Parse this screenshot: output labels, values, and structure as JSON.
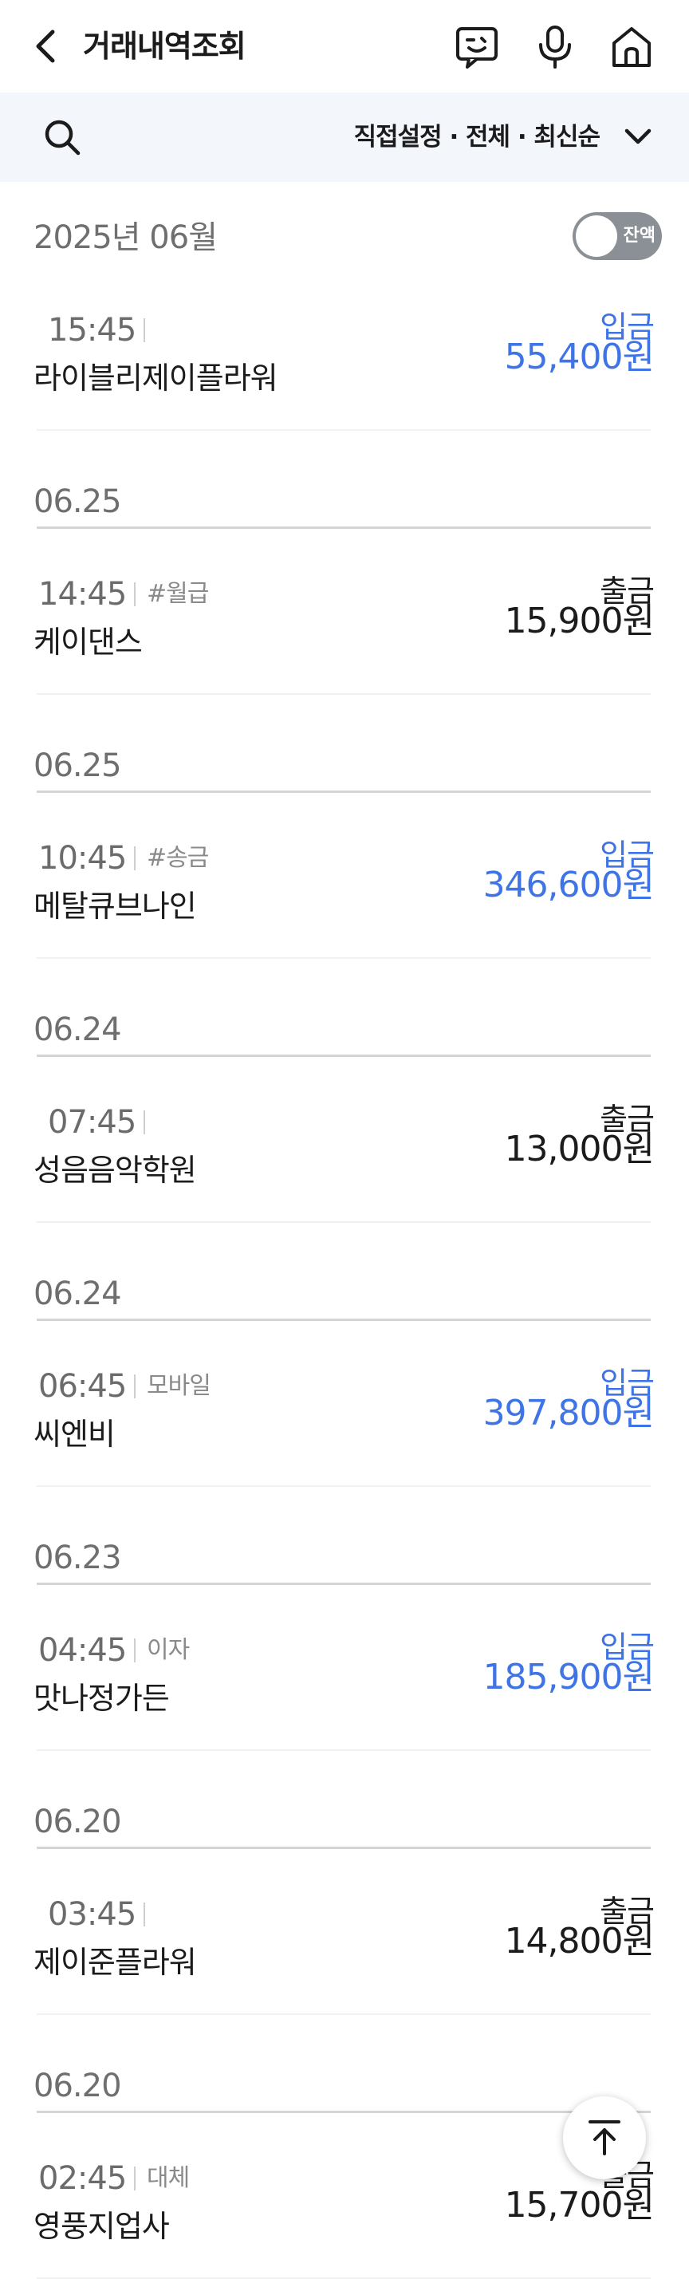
{
  "header": {
    "title": "거래내역조회",
    "icons": [
      "back-icon",
      "chatbot-icon",
      "microphone-icon",
      "home-icon"
    ]
  },
  "filter": {
    "text": "직접설정 · 전체 · 최신순"
  },
  "month": {
    "label": "2025년 06월",
    "balance_toggle_label": "잔액",
    "balance_toggle_on": false
  },
  "transactions": [
    {
      "date": "",
      "time": "15:45",
      "tag": "",
      "merchant": "라이블리제이플라워",
      "type": "입금",
      "amount": "55,400원"
    },
    {
      "date": "06.25",
      "time": "14:45",
      "tag": "#월급",
      "merchant": "케이댄스",
      "type": "출금",
      "amount": "15,900원"
    },
    {
      "date": "06.25",
      "time": "10:45",
      "tag": "#송금",
      "merchant": "메탈큐브나인",
      "type": "입금",
      "amount": "346,600원"
    },
    {
      "date": "06.24",
      "time": "07:45",
      "tag": "",
      "merchant": "성음음악학원",
      "type": "출금",
      "amount": "13,000원"
    },
    {
      "date": "06.24",
      "time": "06:45",
      "tag": "모바일",
      "merchant": "씨엔비",
      "type": "입금",
      "amount": "397,800원"
    },
    {
      "date": "06.23",
      "time": "04:45",
      "tag": "이자",
      "merchant": "맛나정가든",
      "type": "입금",
      "amount": "185,900원"
    },
    {
      "date": "06.20",
      "time": "03:45",
      "tag": "",
      "merchant": "제이준플라워",
      "type": "출금",
      "amount": "14,800원"
    },
    {
      "date": "06.20",
      "time": "02:45",
      "tag": "대체",
      "merchant": "영풍지업사",
      "type": "출금",
      "amount": "15,700원"
    }
  ],
  "colors": {
    "deposit": "#3f74e6",
    "withdrawal": "#1b1b1b",
    "filter_bar_bg": "#f3f6fb"
  }
}
